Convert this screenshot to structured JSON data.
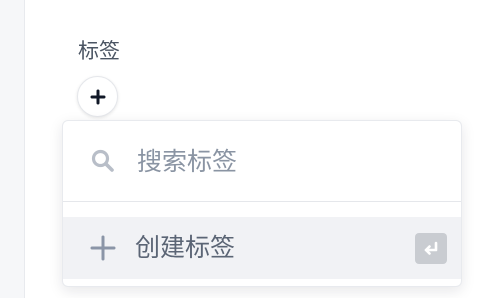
{
  "field": {
    "label": "标签",
    "add_icon": "plus-icon"
  },
  "dropdown": {
    "search": {
      "icon": "search-icon",
      "placeholder": "搜索标签",
      "value": ""
    },
    "create": {
      "icon": "plus-icon",
      "label": "创建标签",
      "shortcut_icon": "enter-key-icon"
    }
  },
  "colors": {
    "text": "#4b5563",
    "placeholder": "#8a94a3",
    "highlight_row": "#f1f2f5",
    "icon_gray": "#8b95a7",
    "dark_icon": "#111827"
  }
}
